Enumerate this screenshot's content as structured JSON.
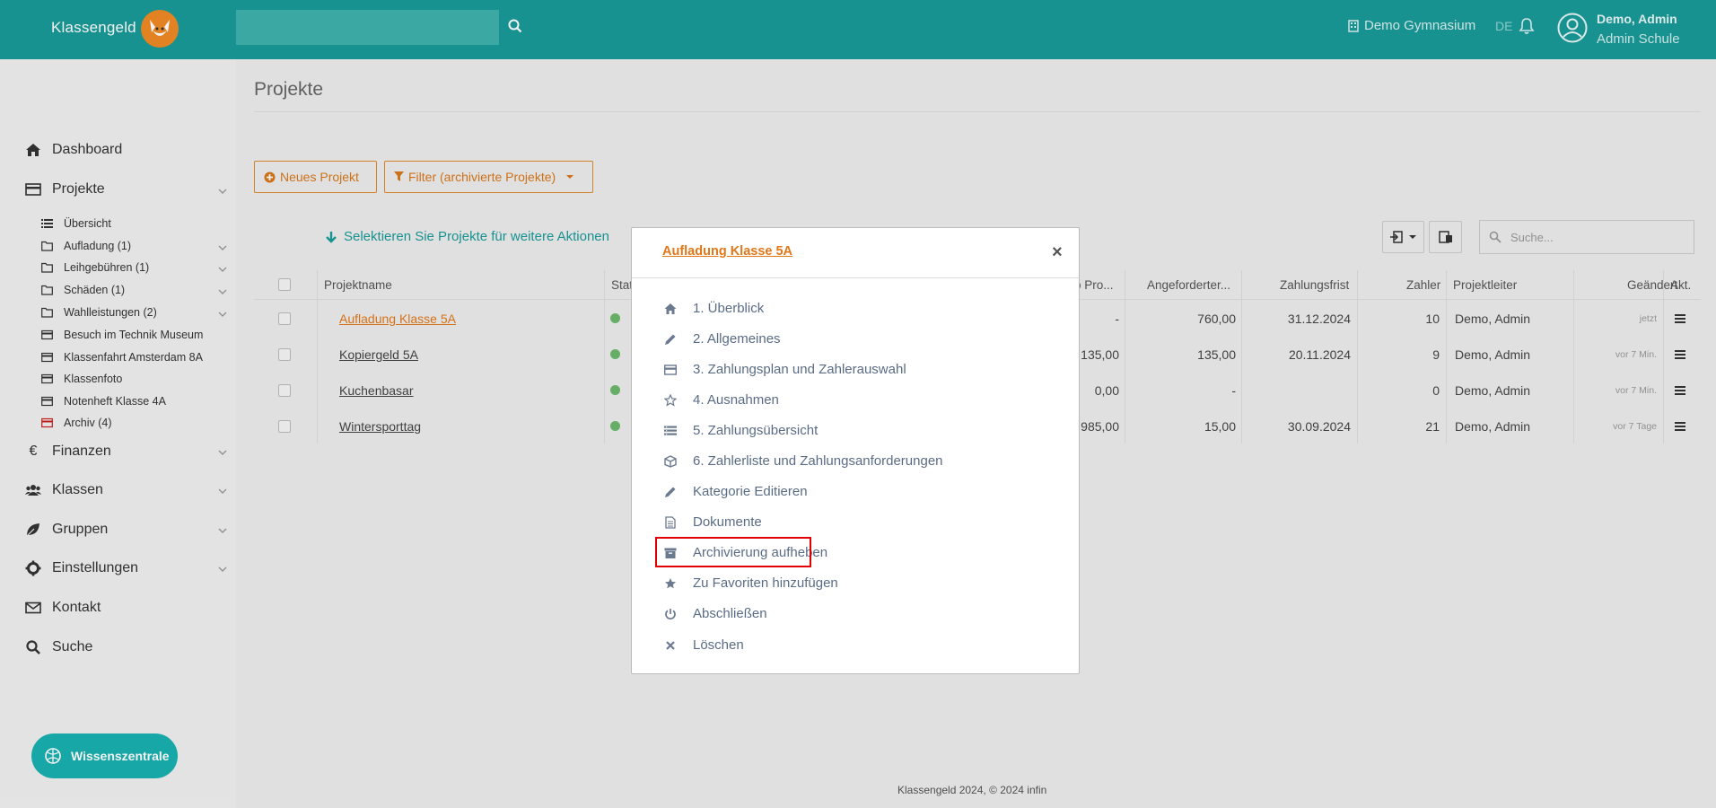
{
  "header": {
    "app_name": "Klassengeld",
    "search_placeholder": "",
    "school": "Demo Gymnasium",
    "language": "DE",
    "user_name": "Demo, Admin",
    "user_role": "Admin Schule"
  },
  "sidebar": {
    "dashboard": "Dashboard",
    "projects": "Projekte",
    "sub_items": [
      {
        "label": "Übersicht",
        "icon": "list-icon"
      },
      {
        "label": "Aufladung (1)",
        "icon": "folder-icon"
      },
      {
        "label": "Leihgebühren (1)",
        "icon": "folder-icon"
      },
      {
        "label": "Schäden (1)",
        "icon": "folder-icon"
      },
      {
        "label": "Wahlleistungen (2)",
        "icon": "folder-icon"
      },
      {
        "label": "Besuch im Technik Museum",
        "icon": "card-icon"
      },
      {
        "label": "Klassenfahrt Amsterdam 8A",
        "icon": "card-icon"
      },
      {
        "label": "Klassenfoto",
        "icon": "card-icon"
      },
      {
        "label": "Notenheft Klasse 4A",
        "icon": "card-icon"
      },
      {
        "label": "Archiv (4)",
        "icon": "archive-card-icon"
      }
    ],
    "finances": "Finanzen",
    "classes": "Klassen",
    "groups": "Gruppen",
    "settings": "Einstellungen",
    "contact": "Kontakt",
    "search": "Suche",
    "knowledge": "Wissenszentrale"
  },
  "main": {
    "title": "Projekte",
    "new_project": "Neues Projekt",
    "filter": "Filter (archivierte Projekte)",
    "select_hint": "Selektieren Sie Projekte für weitere Aktionen",
    "search_placeholder": "Suche...",
    "columns": {
      "name": "Projektname",
      "status": "Stat",
      "pro": "o Pro...",
      "requested": "Angeforderter...",
      "deadline": "Zahlungsfrist",
      "payers": "Zahler",
      "leader": "Projektleiter",
      "changed": "Geändert",
      "actions": "Akt."
    },
    "rows": [
      {
        "name": "Aufladung Klasse 5A",
        "pro": "-",
        "requested": "760,00",
        "deadline": "31.12.2024",
        "payers": "10",
        "leader": "Demo, Admin",
        "changed": "jetzt"
      },
      {
        "name": "Kopiergeld 5A",
        "pro": "135,00",
        "requested": "135,00",
        "deadline": "20.11.2024",
        "payers": "9",
        "leader": "Demo, Admin",
        "changed": "vor 7 Min."
      },
      {
        "name": "Kuchenbasar",
        "pro": "0,00",
        "requested": "-",
        "deadline": "",
        "payers": "0",
        "leader": "Demo, Admin",
        "changed": "vor 7 Min."
      },
      {
        "name": "Wintersporttag",
        "pro": "985,00",
        "requested": "15,00",
        "deadline": "30.09.2024",
        "payers": "21",
        "leader": "Demo, Admin",
        "changed": "vor 7 Tage"
      }
    ],
    "footer": "Klassengeld 2024, © 2024 infin"
  },
  "modal": {
    "title": "Aufladung Klasse 5A",
    "close": "×",
    "items": [
      {
        "label": "1. Überblick",
        "icon": "home-icon"
      },
      {
        "label": "2. Allgemeines",
        "icon": "pencil-icon"
      },
      {
        "label": "3. Zahlungsplan und Zahlerauswahl",
        "icon": "card-icon"
      },
      {
        "label": "4. Ausnahmen",
        "icon": "star-outline-icon"
      },
      {
        "label": "5. Zahlungsübersicht",
        "icon": "list-lines-icon"
      },
      {
        "label": "6. Zahlerliste und Zahlungsanforderungen",
        "icon": "cube-icon"
      },
      {
        "label": "Kategorie Editieren",
        "icon": "pencil-icon"
      },
      {
        "label": "Dokumente",
        "icon": "document-icon"
      },
      {
        "label": "Archivierung aufheben",
        "icon": "archive-icon"
      },
      {
        "label": "Zu Favoriten hinzufügen",
        "icon": "star-icon"
      },
      {
        "label": "Abschließen",
        "icon": "power-icon"
      },
      {
        "label": "Löschen",
        "icon": "times-icon"
      }
    ]
  }
}
